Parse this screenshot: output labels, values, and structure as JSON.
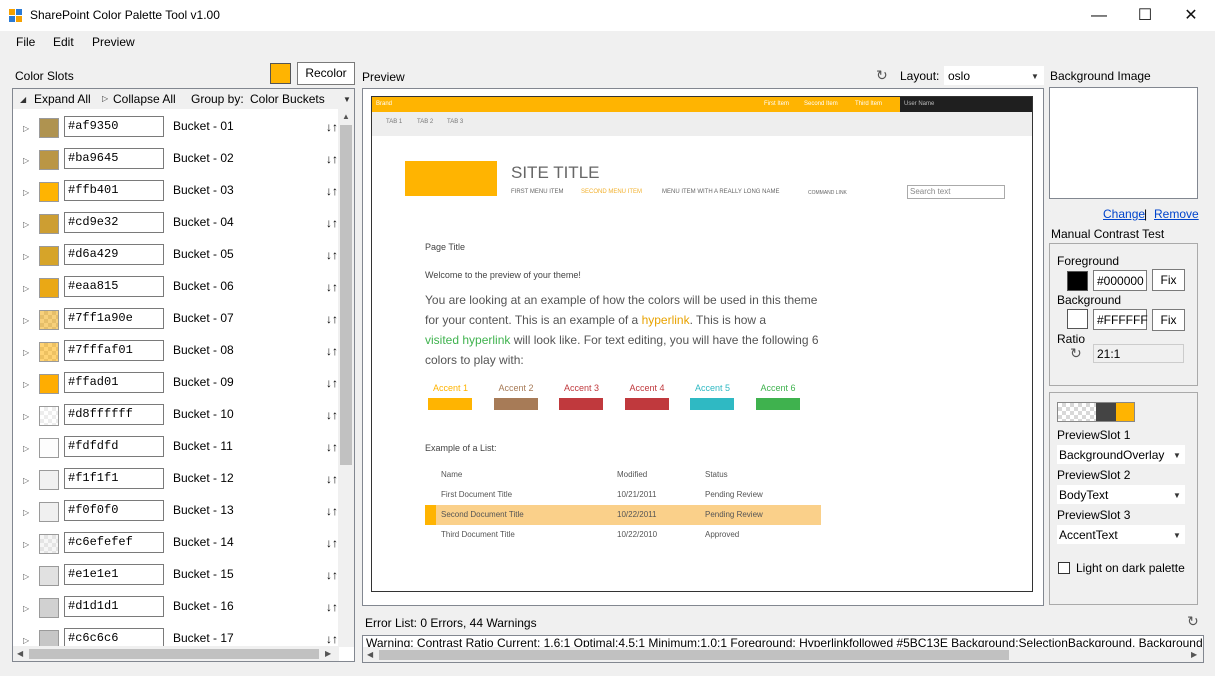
{
  "window": {
    "title": "SharePoint Color Palette Tool v1.00",
    "minimize": "—",
    "maximize": "☐",
    "close": "✕"
  },
  "menu": [
    "File",
    "Edit",
    "Preview"
  ],
  "color_slots": {
    "label": "Color Slots",
    "recolor_label": "Recolor",
    "recolor_swatch": "#ffb401",
    "expand_all": "Expand All",
    "collapse_all": "Collapse All",
    "group_by_label": "Group by:",
    "group_by_value": "Color Buckets",
    "rows": [
      {
        "hex": "#af9350",
        "bucket": "Bucket - 01",
        "color": "#af9350"
      },
      {
        "hex": "#ba9645",
        "bucket": "Bucket - 02",
        "color": "#ba9645"
      },
      {
        "hex": "#ffb401",
        "bucket": "Bucket - 03",
        "color": "#ffb401"
      },
      {
        "hex": "#cd9e32",
        "bucket": "Bucket - 04",
        "color": "#cd9e32"
      },
      {
        "hex": "#d6a429",
        "bucket": "Bucket - 05",
        "color": "#d6a429"
      },
      {
        "hex": "#eaa815",
        "bucket": "Bucket - 06",
        "color": "#eaa815"
      },
      {
        "hex": "#7ff1a90e",
        "bucket": "Bucket - 07",
        "color": "#f1a90e"
      },
      {
        "hex": "#7fffaf01",
        "bucket": "Bucket - 08",
        "color": "#ffaf01"
      },
      {
        "hex": "#ffad01",
        "bucket": "Bucket - 09",
        "color": "#ffad01"
      },
      {
        "hex": "#d8ffffff",
        "bucket": "Bucket - 10",
        "color": "#ffffff"
      },
      {
        "hex": "#fdfdfd",
        "bucket": "Bucket - 11",
        "color": "#fdfdfd"
      },
      {
        "hex": "#f1f1f1",
        "bucket": "Bucket - 12",
        "color": "#f1f1f1"
      },
      {
        "hex": "#f0f0f0",
        "bucket": "Bucket - 13",
        "color": "#f0f0f0"
      },
      {
        "hex": "#c6efefef",
        "bucket": "Bucket - 14",
        "color": "#efefef"
      },
      {
        "hex": "#e1e1e1",
        "bucket": "Bucket - 15",
        "color": "#e1e1e1"
      },
      {
        "hex": "#d1d1d1",
        "bucket": "Bucket - 16",
        "color": "#d1d1d1"
      },
      {
        "hex": "#c6c6c6",
        "bucket": "Bucket - 17",
        "color": "#c6c6c6"
      }
    ]
  },
  "preview": {
    "label": "Preview",
    "layout_label": "Layout:",
    "layout_value": "oslo",
    "suite": {
      "brand": "Brand",
      "items": [
        "First Item",
        "Second Item",
        "Third Item"
      ],
      "user": "User Name",
      "tabs": [
        "TAB 1",
        "TAB 2",
        "TAB 3"
      ]
    },
    "site_title": "SITE TITLE",
    "nav": [
      "FIRST MENU ITEM",
      "SECOND MENU ITEM",
      "MENU ITEM WITH A REALLY LONG NAME",
      "COMMAND LINK"
    ],
    "search_placeholder": "Search text",
    "page_title": "Page Title",
    "welcome": "Welcome to the preview of your theme!",
    "body": {
      "p1": "You are looking at an example of how the colors will be used in this theme for your content. This is an example of a",
      "hyperlink": "hyperlink",
      "p2": ". This is how a",
      "visited": "visited hyperlink",
      "p3": "will look like. For text editing, you will have the following 6 colors to play with:"
    },
    "accents": [
      {
        "label": "Accent 1",
        "color": "#ffb401"
      },
      {
        "label": "Accent 2",
        "color": "#a77b57"
      },
      {
        "label": "Accent 3",
        "color": "#c0393d"
      },
      {
        "label": "Accent 4",
        "color": "#c0393d"
      },
      {
        "label": "Accent 5",
        "color": "#2fb9c3"
      },
      {
        "label": "Accent 6",
        "color": "#3fb24e"
      }
    ],
    "list_title": "Example of a List:",
    "list_headers": [
      "Name",
      "Modified",
      "Status"
    ],
    "list_rows": [
      [
        "First Document Title",
        "10/21/2011",
        "Pending Review"
      ],
      [
        "Second Document Title",
        "10/22/2011",
        "Pending Review"
      ],
      [
        "Third Document Title",
        "10/22/2010",
        "Approved"
      ]
    ]
  },
  "right": {
    "bg_image_label": "Background Image",
    "change": "Change",
    "separator": "|",
    "remove": "Remove",
    "contrast_title": "Manual Contrast Test",
    "foreground_label": "Foreground",
    "foreground_value": "#000000",
    "background_label": "Background",
    "background_value": "#FFFFFF",
    "fix_label": "Fix",
    "ratio_label": "Ratio",
    "ratio_value": "21:1",
    "slot1_label": "PreviewSlot 1",
    "slot1_value": "BackgroundOverlay",
    "slot2_label": "PreviewSlot 2",
    "slot2_value": "BodyText",
    "slot3_label": "PreviewSlot 3",
    "slot3_value": "AccentText",
    "light_on_dark": "Light on dark palette"
  },
  "errors": {
    "title": "Error List: 0 Errors, 44 Warnings",
    "text": "Warning: Contrast Ratio  Current: 1.6:1 Optimal:4.5:1 Minimum:1.0:1 Foreground: Hyperlinkfollowed #5BC13E Background:SelectionBackground, BackgroundOverlay, PageBa"
  },
  "colors": {
    "accent": "#ffb401",
    "selected_row": "#fad08a",
    "link": "#e8a200",
    "visited": "#3fb24e"
  },
  "icons": [
    "refresh-icon",
    "sort-icon",
    "chevron-down-icon"
  ]
}
